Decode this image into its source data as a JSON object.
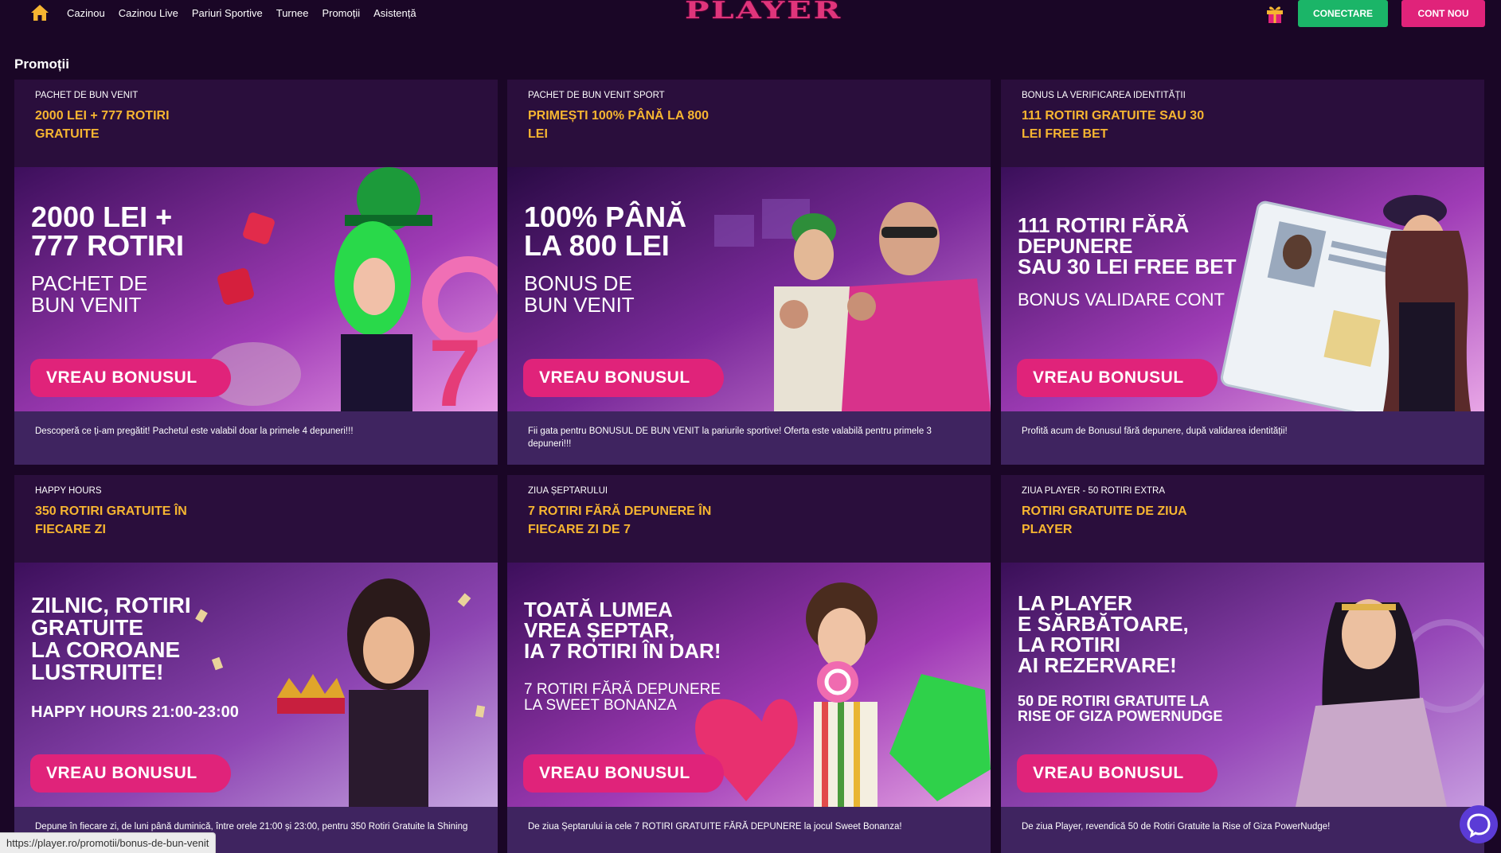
{
  "header": {
    "nav": [
      "Cazinou",
      "Cazinou Live",
      "Pariuri Sportive",
      "Turnee",
      "Promoții",
      "Asistență"
    ],
    "logo": "PLAYER",
    "login_label": "CONECTARE",
    "register_label": "CONT NOU"
  },
  "page_title": "Promoții",
  "button_label": "VREAU BONUSUL",
  "cards": [
    {
      "subtitle": "PACHET DE BUN VENIT",
      "title": "2000 LEI + 777 ROTIRI GRATUITE",
      "banner_headline": "2000 LEI +\n777 ROTIRI",
      "banner_sub": "PACHET DE\nBUN VENIT",
      "description": "Descoperă ce ți-am pregătit! Pachetul este valabil doar la primele 4 depuneri!!!"
    },
    {
      "subtitle": "PACHET DE BUN VENIT SPORT",
      "title": "PRIMEȘTI 100% PÂNĂ LA 800 LEI",
      "banner_headline": "100% PÂNĂ\nLA 800 LEI",
      "banner_sub": "BONUS DE\nBUN VENIT",
      "description": "Fii gata pentru BONUSUL DE BUN VENIT la pariurile sportive! Oferta este valabilă pentru primele 3 depuneri!!!"
    },
    {
      "subtitle": "BONUS LA VERIFICAREA IDENTITĂȚII",
      "title": "111 ROTIRI GRATUITE SAU 30 LEI FREE BET",
      "banner_headline": "111 ROTIRI FĂRĂ\nDEPUNERE\nSAU 30 LEI FREE BET",
      "banner_sub": "BONUS VALIDARE CONT",
      "description": "Profită acum de Bonusul fără depunere, după validarea identității!"
    },
    {
      "subtitle": "HAPPY HOURS",
      "title": "350 ROTIRI GRATUITE ÎN FIECARE ZI",
      "banner_headline": "ZILNIC, ROTIRI\nGRATUITE\nLA COROANE\nLUSTRUITE!",
      "banner_sub": "HAPPY HOURS 21:00-23:00",
      "description": "Depune în fiecare zi, de luni până duminică, între orele 21:00 și 23:00, pentru 350 Rotiri Gratuite la Shining"
    },
    {
      "subtitle": "ZIUA ȘEPTARULUI",
      "title": "7 ROTIRI FĂRĂ DEPUNERE ÎN FIECARE ZI DE 7",
      "banner_headline": "TOATĂ LUMEA\nVREA ȘEPTAR,\nIA 7 ROTIRI ÎN DAR!",
      "banner_sub": "7 ROTIRI FĂRĂ DEPUNERE\nLA SWEET BONANZA",
      "description": "De ziua Șeptarului ia cele 7 ROTIRI GRATUITE FĂRĂ DEPUNERE la jocul Sweet Bonanza!"
    },
    {
      "subtitle": "ZIUA PLAYER - 50 ROTIRI EXTRA",
      "title": "ROTIRI GRATUITE DE ZIUA PLAYER",
      "banner_headline": "LA PLAYER\nE SĂRBĂTOARE,\nLA ROTIRI\nAI REZERVARE!",
      "banner_sub": "50 DE ROTIRI GRATUITE LA\nRISE OF GIZA POWERNUDGE",
      "description": "De ziua Player, revendică 50 de Rotiri Gratuite la Rise of Giza PowerNudge!"
    }
  ],
  "statusbar_url": "https://player.ro/promotii/bonus-de-bun-venit",
  "colors": {
    "background": "#1a0626",
    "card": "#2a0e3c",
    "description": "#3f2460",
    "title_gold": "#f6b531",
    "accent_pink": "#e0237a",
    "accent_green": "#1bb568"
  },
  "icons": [
    "home-icon",
    "gift-icon",
    "chat-icon"
  ]
}
